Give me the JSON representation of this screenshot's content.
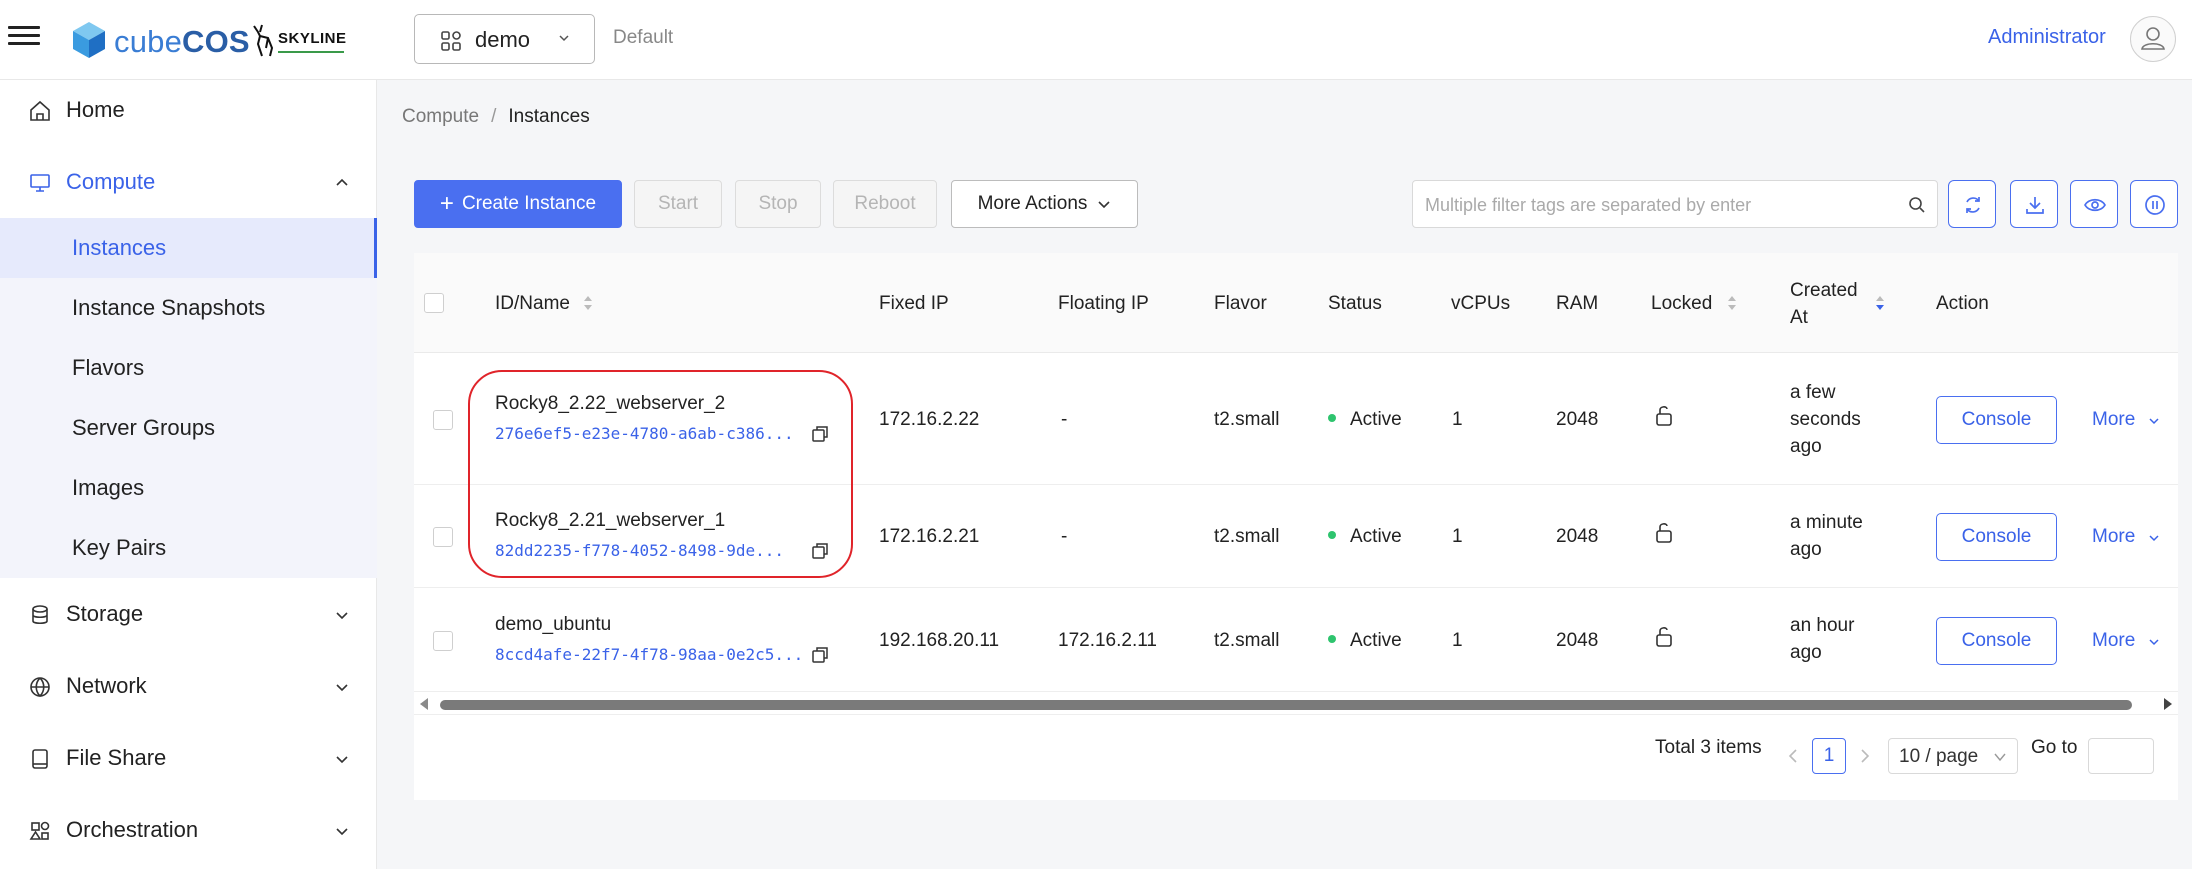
{
  "header": {
    "logo_text_light": "cube",
    "logo_text_bold": "COS",
    "partner_logo": "SKYLINE",
    "project": "demo",
    "domain": "Default",
    "user": "Administrator"
  },
  "sidebar": {
    "items": [
      {
        "label": "Home",
        "icon": "home-icon"
      },
      {
        "label": "Compute",
        "icon": "monitor-icon"
      },
      {
        "label": "Storage",
        "icon": "database-icon"
      },
      {
        "label": "Network",
        "icon": "globe-icon"
      },
      {
        "label": "File Share",
        "icon": "file-share-icon"
      },
      {
        "label": "Orchestration",
        "icon": "orchestration-icon"
      }
    ],
    "compute_sub": [
      {
        "label": "Instances"
      },
      {
        "label": "Instance Snapshots"
      },
      {
        "label": "Flavors"
      },
      {
        "label": "Server Groups"
      },
      {
        "label": "Images"
      },
      {
        "label": "Key Pairs"
      }
    ]
  },
  "breadcrumb": {
    "parent": "Compute",
    "separator": "/",
    "current": "Instances"
  },
  "toolbar": {
    "create": "Create Instance",
    "start": "Start",
    "stop": "Stop",
    "reboot": "Reboot",
    "more_actions": "More Actions",
    "search_placeholder": "Multiple filter tags are separated by enter"
  },
  "table": {
    "columns": {
      "id_name": "ID/Name",
      "fixed_ip": "Fixed IP",
      "floating_ip": "Floating IP",
      "flavor": "Flavor",
      "status": "Status",
      "vcpus": "vCPUs",
      "ram": "RAM",
      "locked": "Locked",
      "created_line1": "Created",
      "created_line2": "At",
      "action": "Action"
    },
    "rows": [
      {
        "name": "Rocky8_2.22_webserver_2",
        "id": "276e6ef5-e23e-4780-a6ab-c386...",
        "fixed_ip": "172.16.2.22",
        "floating_ip": "-",
        "flavor": "t2.small",
        "status": "Active",
        "vcpus": "1",
        "ram": "2048",
        "created_l1": "a few",
        "created_l2": "seconds",
        "created_l3": "ago",
        "console": "Console",
        "more": "More"
      },
      {
        "name": "Rocky8_2.21_webserver_1",
        "id": "82dd2235-f778-4052-8498-9de...",
        "fixed_ip": "172.16.2.21",
        "floating_ip": "-",
        "flavor": "t2.small",
        "status": "Active",
        "vcpus": "1",
        "ram": "2048",
        "created_l1": "a minute",
        "created_l2": "ago",
        "created_l3": "",
        "console": "Console",
        "more": "More"
      },
      {
        "name": "demo_ubuntu",
        "id": "8ccd4afe-22f7-4f78-98aa-0e2c5...",
        "fixed_ip": "192.168.20.11",
        "floating_ip": "172.16.2.11",
        "flavor": "t2.small",
        "status": "Active",
        "vcpus": "1",
        "ram": "2048",
        "created_l1": "an hour",
        "created_l2": "ago",
        "created_l3": "",
        "console": "Console",
        "more": "More"
      }
    ]
  },
  "pagination": {
    "total": "Total 3 items",
    "current_page": "1",
    "page_size": "10 / page",
    "goto": "Go to"
  },
  "colors": {
    "accent": "#4a6ff0",
    "status_active": "#2ec46e",
    "highlight": "#e0242a"
  }
}
